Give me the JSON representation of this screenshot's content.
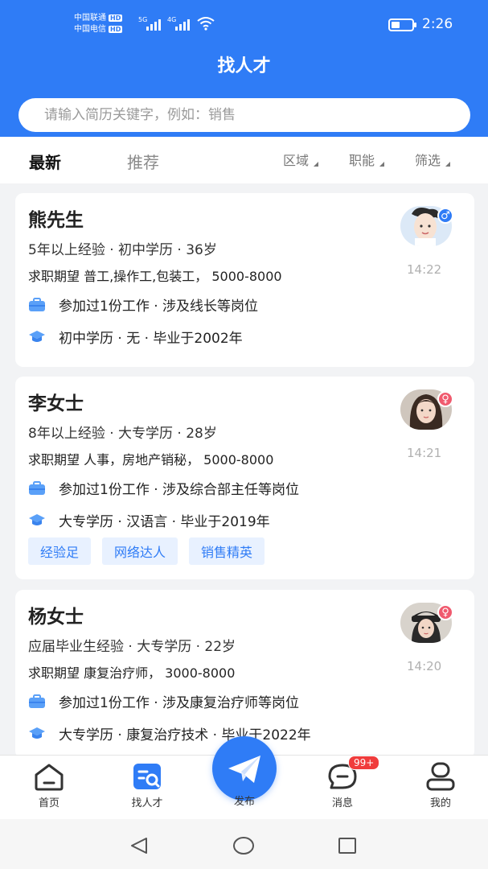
{
  "status_bar": {
    "carrier1": "中国联通",
    "carrier2": "中国电信",
    "hd": "HD",
    "net1": "5G",
    "net2": "4G",
    "time": "2:26"
  },
  "header": {
    "title": "找人才",
    "search_placeholder": "请输入简历关键字，例如：销售"
  },
  "tabs": {
    "latest": "最新",
    "recommend": "推荐"
  },
  "filters": {
    "area": "区域",
    "function": "职能",
    "filter": "筛选"
  },
  "candidates": [
    {
      "name": "熊先生",
      "summary": "5年以上经验 · 初中学历 · 36岁",
      "expectation": "求职期望 普工,操作工,包装工， 5000-8000",
      "work": "参加过1份工作 · 涉及线长等岗位",
      "education": "初中学历 · 无 · 毕业于2002年",
      "time": "14:22",
      "gender_icon": "♂",
      "tags": []
    },
    {
      "name": "李女士",
      "summary": "8年以上经验 · 大专学历 · 28岁",
      "expectation": "求职期望 人事，房地产销秘， 5000-8000",
      "work": "参加过1份工作 · 涉及综合部主任等岗位",
      "education": "大专学历 · 汉语言 · 毕业于2019年",
      "time": "14:21",
      "gender_icon": "♀",
      "tags": [
        "经验足",
        "网络达人",
        "销售精英"
      ]
    },
    {
      "name": "杨女士",
      "summary": "应届毕业生经验 · 大专学历 · 22岁",
      "expectation": "求职期望 康复治疗师， 3000-8000",
      "work": "参加过1份工作 · 涉及康复治疗师等岗位",
      "education": "大专学历 · 康复治疗技术 · 毕业于2022年",
      "time": "14:20",
      "gender_icon": "♀",
      "tags": []
    }
  ],
  "bottom_nav": {
    "home": "首页",
    "find_talent": "找人才",
    "publish": "发布",
    "messages": "消息",
    "messages_badge": "99+",
    "mine": "我的"
  },
  "colors": {
    "brand": "#2f7cf6",
    "male": "#2f7cf6",
    "female": "#f05a6e",
    "badge": "#f03c3c",
    "tag_bg": "#e8f1ff"
  }
}
